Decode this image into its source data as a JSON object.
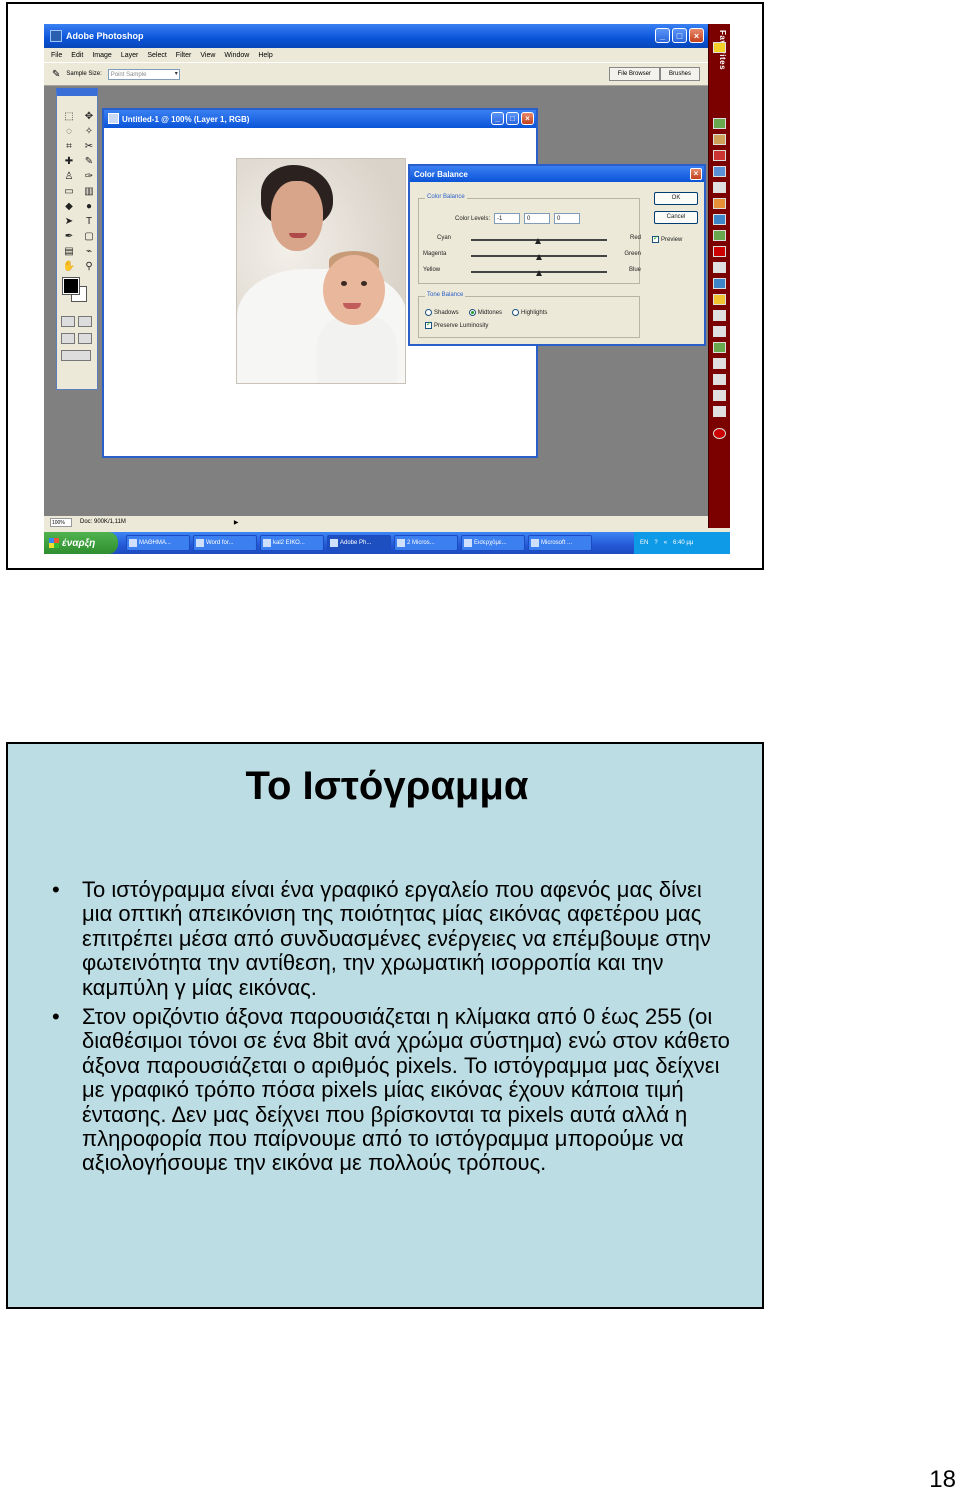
{
  "photoshop": {
    "title": "Adobe Photoshop",
    "menu": [
      "File",
      "Edit",
      "Image",
      "Layer",
      "Select",
      "Filter",
      "View",
      "Window",
      "Help"
    ],
    "options": {
      "sample_size_label": "Sample Size:",
      "sample_size_value": "Point Sample"
    },
    "palette_well": [
      "File Browser",
      "Brushes"
    ],
    "status": {
      "zoom": "100%",
      "doc": "Doc: 900K/1,11M"
    }
  },
  "document": {
    "title": "Untitled-1 @ 100% (Layer 1, RGB)"
  },
  "color_balance": {
    "title": "Color Balance",
    "group_color": "Color Balance",
    "levels_label": "Color Levels:",
    "levels": [
      "-1",
      "0",
      "0"
    ],
    "sliders": [
      {
        "left": "Cyan",
        "right": "Red",
        "value": -1
      },
      {
        "left": "Magenta",
        "right": "Green",
        "value": 0
      },
      {
        "left": "Yellow",
        "right": "Blue",
        "value": 0
      }
    ],
    "ok": "OK",
    "cancel": "Cancel",
    "preview": "Preview",
    "group_tone": "Tone Balance",
    "tones": [
      "Shadows",
      "Midtones",
      "Highlights"
    ],
    "selected_tone": "Midtones",
    "preserve": "Preserve Luminosity"
  },
  "favorites": {
    "title": "Favorites"
  },
  "taskbar": {
    "start": "έναρξη",
    "items": [
      "ΜΑΘΗΜΑ...",
      "Word for...",
      "kal2 ΕΙΚΟ...",
      "Adobe Ph...",
      "2 Micros...",
      "Εισερχόμε...",
      "Microsoft ..."
    ],
    "lang": "EN",
    "clock": "6:40 μμ"
  },
  "slide": {
    "title": "Το Ιστόγραμμα",
    "bullets": [
      "Το ιστόγραμμα είναι ένα γραφικό εργαλείο που αφενός μας δίνει μια οπτική απεικόνιση της ποιότητας μίας εικόνας αφετέρου μας επιτρέπει μέσα από συνδυασμένες ενέργειες να επέμβουμε στην φωτεινότητα την αντίθεση, την χρωματική ισορροπία και την καμπύλη γ μίας εικόνας.",
      "Στον οριζόντιο άξονα παρουσιάζεται η κλίμακα από 0 έως 255 (οι διαθέσιμοι τόνοι σε ένα 8bit ανά χρώμα σύστημα) ενώ στον κάθετο άξονα παρουσιάζεται ο αριθμός pixels. Το ιστόγραμμα μας δείχνει με γραφικό τρόπο πόσα pixels μίας εικόνας έχουν κάποια τιμή έντασης. Δεν μας δείχνει που βρίσκονται τα pixels αυτά αλλά η πληροφορία που παίρνουμε από το ιστόγραμμα μπορούμε να αξιολογήσουμε την εικόνα με πολλούς τρόπους."
    ]
  },
  "page_number": "18"
}
